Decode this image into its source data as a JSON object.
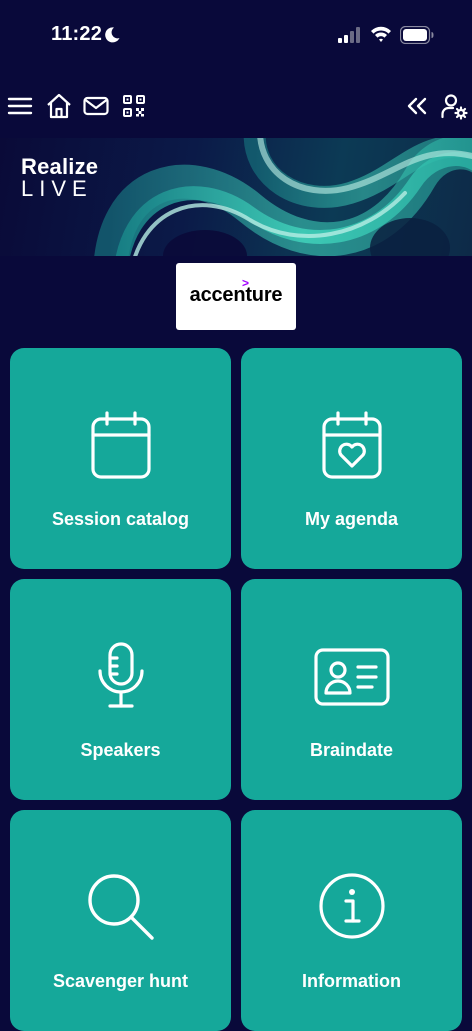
{
  "status": {
    "time": "11:22"
  },
  "banner": {
    "title_line1": "Realize",
    "title_line2": "LIVE"
  },
  "sponsor": {
    "name": "accenture",
    "mark": ">"
  },
  "tiles": [
    {
      "label": "Session catalog",
      "icon": "calendar-icon"
    },
    {
      "label": "My agenda",
      "icon": "calendar-heart-icon"
    },
    {
      "label": "Speakers",
      "icon": "microphone-icon"
    },
    {
      "label": "Braindate",
      "icon": "id-card-icon"
    },
    {
      "label": "Scavenger hunt",
      "icon": "search-icon"
    },
    {
      "label": "Information",
      "icon": "info-icon"
    }
  ],
  "colors": {
    "background": "#09093a",
    "tile": "#15a89a",
    "accent": "#a100ff"
  }
}
